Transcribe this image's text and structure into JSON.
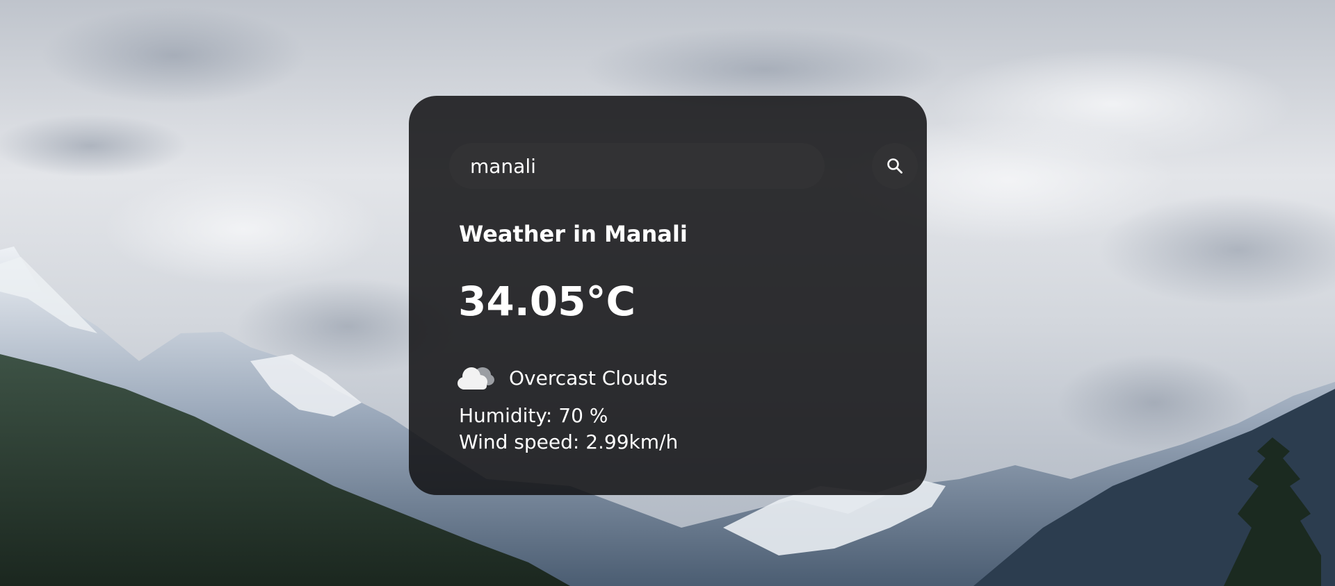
{
  "search": {
    "value": "manali",
    "button_icon": "search-icon"
  },
  "weather": {
    "title": "Weather in Manali",
    "temperature": "34.05°C",
    "description": "Overcast Clouds",
    "description_icon": "cloud-icon",
    "humidity": "Humidity: 70 %",
    "wind": "Wind speed: 2.99km/h"
  },
  "colors": {
    "card_background": "#161618",
    "input_background": "#323234",
    "text": "#ffffff"
  }
}
